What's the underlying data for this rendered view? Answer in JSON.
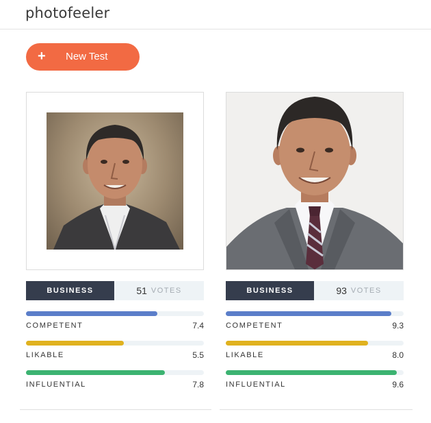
{
  "app": {
    "logo_text": "photofeeler"
  },
  "actions": {
    "new_test_label": "New Test",
    "new_test_icon": "+"
  },
  "colors": {
    "accent": "#f26a43",
    "badge": "#353d4d",
    "competent": "#5b7ec9",
    "likable": "#e0b21f",
    "influential": "#3cb371"
  },
  "tests": [
    {
      "category": "BUSINESS",
      "votes": "51",
      "votes_word": "VOTES",
      "metrics": [
        {
          "name": "COMPETENT",
          "score": "7.4",
          "fraction": 0.74
        },
        {
          "name": "LIKABLE",
          "score": "5.5",
          "fraction": 0.55
        },
        {
          "name": "INFLUENTIAL",
          "score": "7.8",
          "fraction": 0.78
        }
      ]
    },
    {
      "category": "BUSINESS",
      "votes": "93",
      "votes_word": "VOTES",
      "metrics": [
        {
          "name": "COMPETENT",
          "score": "9.3",
          "fraction": 0.93
        },
        {
          "name": "LIKABLE",
          "score": "8.0",
          "fraction": 0.8
        },
        {
          "name": "INFLUENTIAL",
          "score": "9.6",
          "fraction": 0.96
        }
      ]
    }
  ]
}
